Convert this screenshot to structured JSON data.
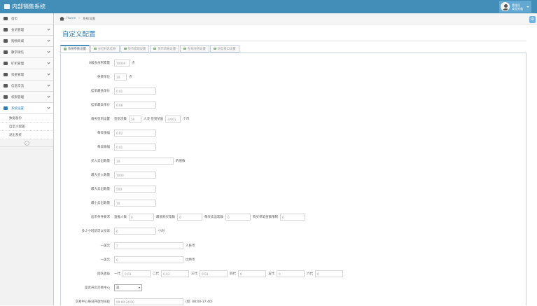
{
  "app": {
    "title": "内部销售系统"
  },
  "user": {
    "line1": "管理员",
    "line2": "欢迎光临"
  },
  "breadcrumb": {
    "home": "Home",
    "sep": ">",
    "current": "系统设置"
  },
  "page": {
    "title": "自定义配置"
  },
  "sidebar": {
    "items": [
      {
        "label": "首页"
      },
      {
        "label": "会员管理"
      },
      {
        "label": "购物商城"
      },
      {
        "label": "數字微信"
      },
      {
        "label": "矿机管理"
      },
      {
        "label": "资金管理"
      },
      {
        "label": "信息交流"
      },
      {
        "label": "权限管理"
      },
      {
        "label": "系统设置"
      }
    ],
    "sub_items": [
      {
        "label": "数据备份"
      },
      {
        "label": "自定义配置"
      },
      {
        "label": "退出系统"
      }
    ],
    "collapse_glyph": "«"
  },
  "tabs": [
    {
      "label": "系统参数设置"
    },
    {
      "label": "分红利息挂帐"
    },
    {
      "label": "货币提现设置"
    },
    {
      "label": "货币转帐设置"
    },
    {
      "label": "在线充值设置"
    },
    {
      "label": "短信接口设置"
    }
  ],
  "form": {
    "r1": {
      "label": "0级会员积累量",
      "value": "10000",
      "unit": "点"
    },
    "r2": {
      "label": "免费单位",
      "value": "10",
      "unit": "点"
    },
    "r3": {
      "label": "挂单最低单价",
      "value": "0.01"
    },
    "r4": {
      "label": "挂单最高单价",
      "value": "0.08"
    },
    "r5": {
      "label": "每天签到设置",
      "t1": "签到次数",
      "v1": "50",
      "t2": "人次 签到奖励",
      "v2": "0.001",
      "t3": "个币"
    },
    "r6": {
      "label": "每日涨幅",
      "value": "0.02"
    },
    "r7": {
      "label": "每日跌幅",
      "value": "0.01"
    },
    "r8": {
      "label": "买入卖出数量",
      "value": "10",
      "unit": "的倍数"
    },
    "r9": {
      "label": "最大买入数量",
      "value": "1000"
    },
    "r10": {
      "label": "最大卖出数量",
      "value": "500"
    },
    "r11": {
      "label": "最小卖出数量",
      "value": "10"
    },
    "r12": {
      "label": "出币条件要求",
      "a": "直推人数",
      "av": "0",
      "b": "最低购买笔数",
      "bv": "0",
      "c": "每天卖出笔数",
      "cv": "0",
      "d": "购买单笔金额限制",
      "dv": "0"
    },
    "r13": {
      "label": "多少小时前可以投诉",
      "value": "6",
      "unit": "小时"
    },
    "r14": {
      "label": "一美元",
      "value": "7",
      "unit": "人民币"
    },
    "r15": {
      "label": "一美元",
      "value": "0",
      "unit": "比特币"
    },
    "r16": {
      "label": "团队收益",
      "l1": "一代",
      "v1": "0.03",
      "l2": "二代",
      "v2": "0.03",
      "l3": "三代",
      "v3": "0.03",
      "l4": "四代",
      "v4": "0",
      "l5": "五代",
      "v5": "0",
      "l6": "六代",
      "v6": "0"
    },
    "r17": {
      "label": "是否开启交易中心",
      "value": "是"
    },
    "r18": {
      "label": "交易中心每日开放时间段",
      "value": "00:00-24:00",
      "hint": "(如: 08:00-17:40)"
    }
  }
}
